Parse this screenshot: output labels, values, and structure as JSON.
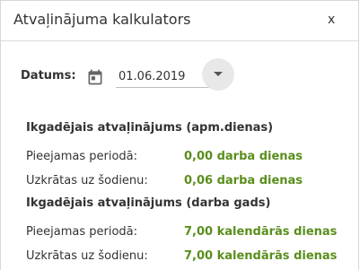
{
  "dialog": {
    "title": "Atvaļinājuma kalkulators",
    "close_label": "x"
  },
  "date": {
    "label": "Datums:",
    "value": "01.06.2019",
    "calendar_icon": "calendar-icon",
    "dropdown_icon": "caret-down-icon"
  },
  "sections": [
    {
      "title": "Ikgadējais atvaļinājums (apm.dienas)",
      "rows": [
        {
          "label": "Pieejamas periodā:",
          "value": "0,00 darba dienas"
        },
        {
          "label": "Uzkrātas uz šodienu:",
          "value": "0,06 darba dienas"
        }
      ]
    },
    {
      "title": "Ikgadējais atvaļinājums (darba gads)",
      "rows": [
        {
          "label": "Pieejamas periodā:",
          "value": "7,00 kalendārās dienas"
        },
        {
          "label": "Uzkrātas uz šodienu:",
          "value": "7,00 kalendārās dienas"
        }
      ]
    }
  ],
  "colors": {
    "value_green": "#5a8e1c",
    "text": "#333333",
    "divider": "#dcdcdc"
  }
}
